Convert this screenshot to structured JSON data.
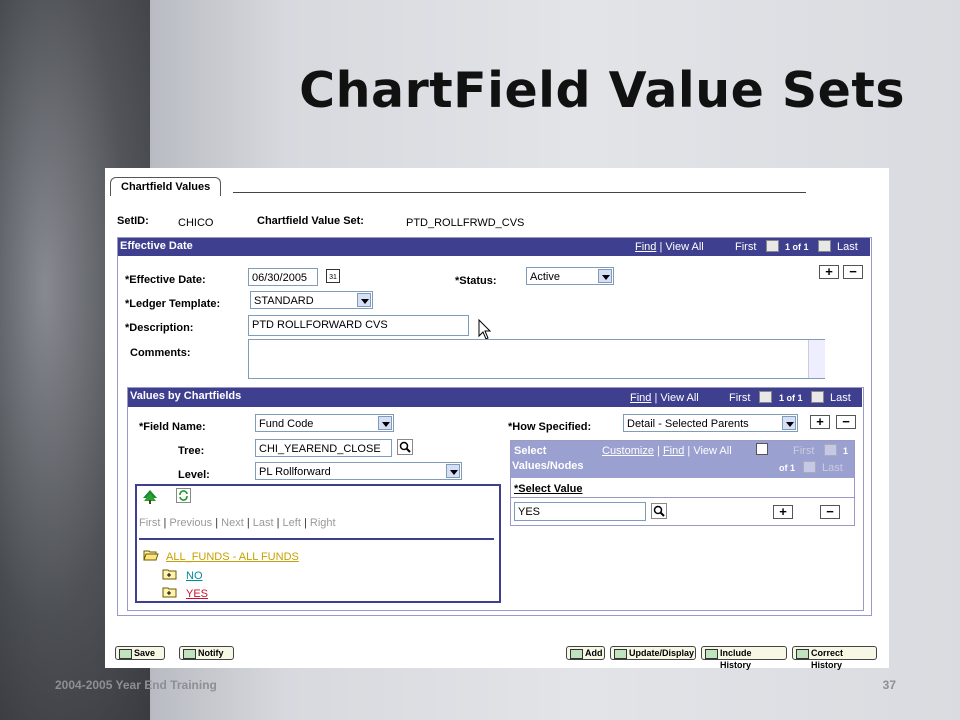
{
  "slide": {
    "title": "ChartField Value Sets",
    "footer": "2004-2005 Year End Training",
    "page_number": "37"
  },
  "tab": {
    "label": "Chartfield Values"
  },
  "header": {
    "setid_label": "SetID:",
    "setid_value": "CHICO",
    "cvs_label": "Chartfield Value Set:",
    "cvs_value": "PTD_ROLLFRWD_CVS"
  },
  "effdate_section": {
    "title": "Effective Date",
    "find": "Find",
    "view_all": "View All",
    "first": "First",
    "count": "1 of 1",
    "last": "Last"
  },
  "form": {
    "eff_date_label": "*Effective Date:",
    "eff_date_value": "06/30/2005",
    "calendar_icon": "calendar-icon",
    "status_label": "*Status:",
    "status_value": "Active",
    "ledger_label": "*Ledger Template:",
    "ledger_value": "STANDARD",
    "desc_label": "*Description:",
    "desc_value": "PTD ROLLFORWARD CVS",
    "comments_label": "Comments:",
    "comments_value": ""
  },
  "values_section": {
    "title": "Values by Chartfields",
    "find": "Find",
    "view_all": "View All",
    "first": "First",
    "count": "1 of 1",
    "last": "Last"
  },
  "fields": {
    "field_name_label": "*Field Name:",
    "field_name_value": "Fund Code",
    "tree_label": "Tree:",
    "tree_value": "CHI_YEAREND_CLOSE",
    "level_label": "Level:",
    "level_value": "PL Rollforward",
    "how_label": "*How Specified:",
    "how_value": "Detail - Selected Parents"
  },
  "tree_nav": {
    "first": "First",
    "previous": "Previous",
    "next": "Next",
    "last": "Last",
    "left": "Left",
    "right": "Right"
  },
  "tree_nodes": {
    "root": "ALL_FUNDS - ALL FUNDS",
    "child1": "NO",
    "child2": "YES"
  },
  "select_grid": {
    "title_line1": "Select",
    "title_line2": "Values/Nodes",
    "customize": "Customize",
    "find": "Find",
    "view_all": "View All",
    "first": "First",
    "count": "1",
    "of": "of 1",
    "last": "Last",
    "col_header": "*Select Value",
    "value": "YES"
  },
  "toolbar": {
    "save": "Save",
    "notify": "Notify",
    "add": "Add",
    "update": "Update/Display",
    "include_history": "Include History",
    "correct_history": "Correct History"
  },
  "colors": {
    "section_header": "#3f3f8f",
    "accent_link": "#c8a000"
  }
}
